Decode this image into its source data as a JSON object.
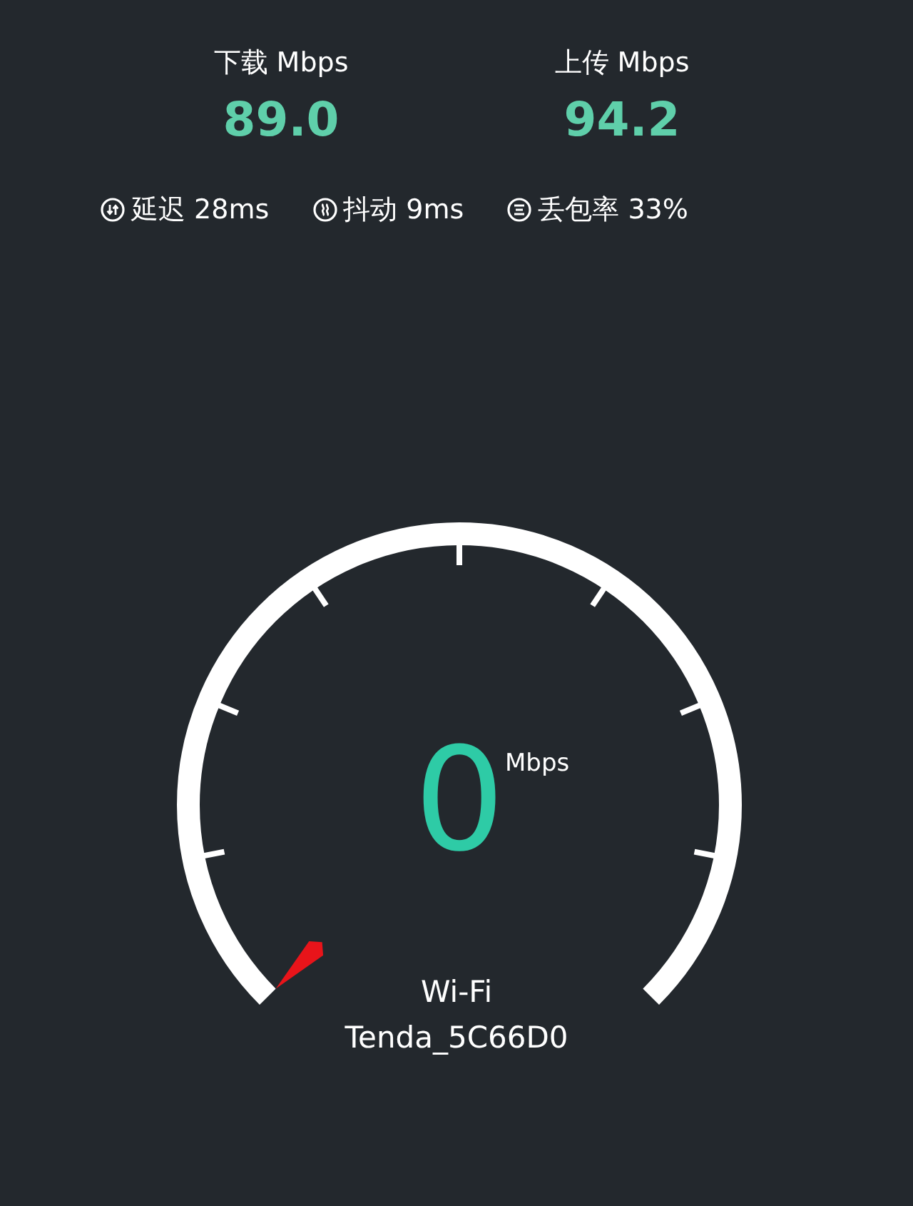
{
  "results": [
    {
      "label": "下载 Mbps",
      "value": "89.0"
    },
    {
      "label": "上传 Mbps",
      "value": "94.2"
    }
  ],
  "stats": [
    {
      "kind": "latency",
      "text": "延迟 28ms"
    },
    {
      "kind": "jitter",
      "text": "抖动 9ms"
    },
    {
      "kind": "loss",
      "text": "丢包率 33%"
    }
  ],
  "gauge": {
    "value": "0",
    "unit": "Mbps",
    "network_type": "Wi-Fi",
    "network_name": "Tenda_5C66D0"
  }
}
